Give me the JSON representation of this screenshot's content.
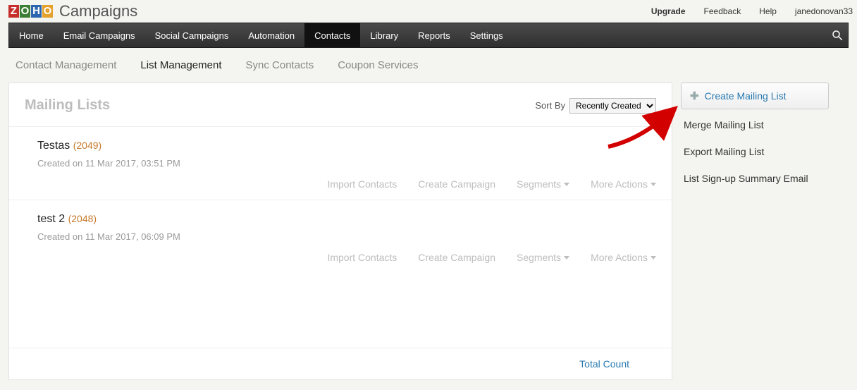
{
  "top": {
    "brand_text": "Campaigns",
    "links": {
      "upgrade": "Upgrade",
      "feedback": "Feedback",
      "help": "Help",
      "user": "janedonovan33"
    }
  },
  "nav": {
    "items": [
      "Home",
      "Email Campaigns",
      "Social Campaigns",
      "Automation",
      "Contacts",
      "Library",
      "Reports",
      "Settings"
    ],
    "active": "Contacts"
  },
  "subnav": {
    "items": [
      "Contact Management",
      "List Management",
      "Sync Contacts",
      "Coupon Services"
    ],
    "active": "List Management"
  },
  "panel": {
    "title": "Mailing Lists",
    "sort_label": "Sort By",
    "sort_selected": "Recently Created",
    "total_label": "Total Count"
  },
  "lists": [
    {
      "name": "Testas",
      "count": "(2049)",
      "created_prefix": "Created on ",
      "created": "11 Mar 2017, 03:51 PM"
    },
    {
      "name": "test 2",
      "count": "(2048)",
      "created_prefix": "Created on ",
      "created": "11 Mar 2017, 06:09 PM"
    }
  ],
  "row_actions": {
    "import": "Import Contacts",
    "create": "Create Campaign",
    "segments": "Segments",
    "more": "More Actions"
  },
  "sidebar": {
    "create": "Create Mailing List",
    "merge": "Merge Mailing List",
    "export": "Export Mailing List",
    "signup": "List Sign-up Summary Email"
  }
}
